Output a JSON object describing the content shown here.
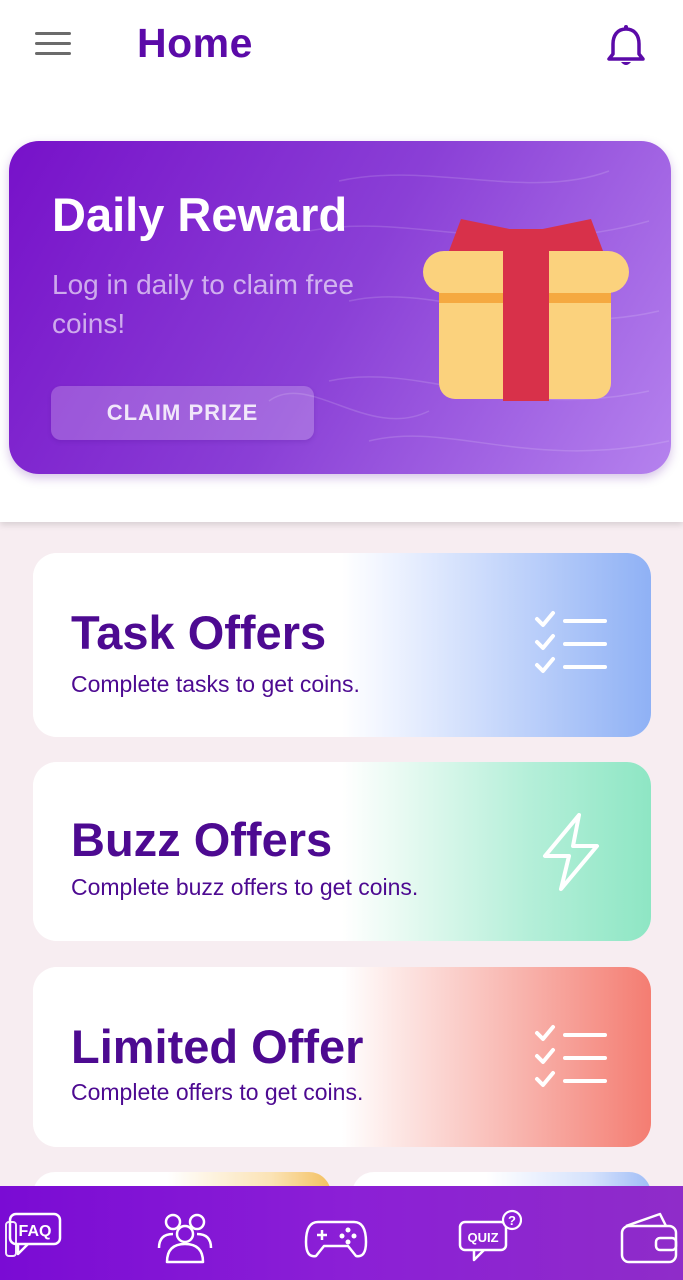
{
  "header": {
    "title": "Home"
  },
  "reward": {
    "title": "Daily Reward",
    "subtitle": "Log in daily to claim free coins!",
    "button_label": "CLAIM PRIZE"
  },
  "offers": [
    {
      "title": "Task Offers",
      "subtitle": "Complete tasks to get coins.",
      "icon": "checklist-icon",
      "accent": "#8fb1f5"
    },
    {
      "title": "Buzz Offers",
      "subtitle": "Complete buzz offers to get coins.",
      "icon": "lightning-icon",
      "accent": "#8ee6c4"
    },
    {
      "title": "Limited Offer",
      "subtitle": "Complete offers to get coins.",
      "icon": "checklist-icon",
      "accent": "#f47d72"
    }
  ],
  "bottom_nav": {
    "faq_label": "FAQ",
    "quiz_label": "QUIZ",
    "items": [
      "faq-icon",
      "users-icon",
      "gamepad-icon",
      "quiz-icon",
      "wallet-icon"
    ]
  },
  "colors": {
    "brand": "#5b0aa8",
    "reward_gradient_start": "#7711c9",
    "reward_gradient_end": "#b582ee",
    "nav_bar": "#7a0bd4",
    "gift_body": "#fbd27d",
    "gift_ribbon": "#d8314a"
  }
}
